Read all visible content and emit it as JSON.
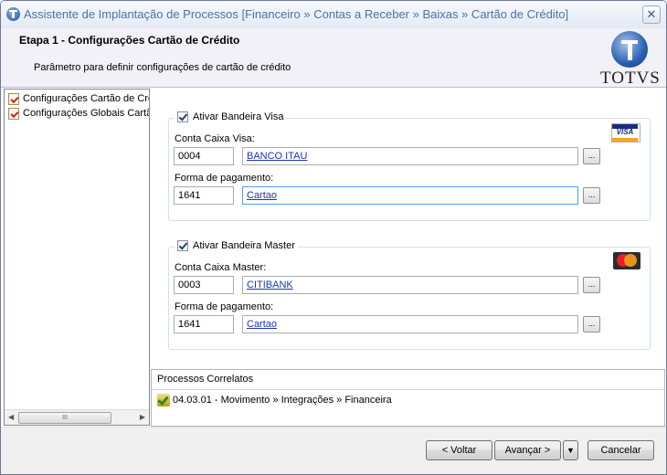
{
  "window": {
    "title": "Assistente de Implantação de Processos [Financeiro » Contas a Receber » Baixas » Cartão de Crédito]",
    "close_symbol": "✕",
    "app_icon": "totvs-circle-icon"
  },
  "header": {
    "step_title": "Etapa 1 - Configurações Cartão de Crédito",
    "step_description": "Parâmetro para definir configurações de cartão de crédito",
    "logo_text": "TOTVS"
  },
  "tree": {
    "items": [
      {
        "label": "Configurações Cartão de Crédito",
        "icon": "checklist-icon"
      },
      {
        "label": "Configurações Globais Cartão",
        "icon": "checklist-icon"
      }
    ],
    "scroll_left": "◀",
    "scroll_right": "▶",
    "scroll_thumb": "III"
  },
  "visa": {
    "checkbox_label": "Ativar Bandeira Visa",
    "checked": true,
    "account_label": "Conta Caixa Visa:",
    "account_code": "0004",
    "account_name": "BANCO ITAU",
    "payment_label": "Forma de pagamento:",
    "payment_code": "1641",
    "payment_name": "Cartao",
    "logo_text": "VISA",
    "lookup_label": "..."
  },
  "master": {
    "checkbox_label": "Ativar Bandeira Master",
    "checked": true,
    "account_label": "Conta Caixa Master:",
    "account_code": "0003",
    "account_name": "CITIBANK",
    "payment_label": "Forma de pagamento:",
    "payment_code": "1641",
    "payment_name": "Cartao",
    "lookup_label": "..."
  },
  "related": {
    "header": "Processos Correlatos",
    "items": [
      {
        "label": "04.03.01 - Movimento » Integrações » Financeira"
      }
    ]
  },
  "footer": {
    "back_label": "< Voltar",
    "next_label": "Avançar >",
    "dropdown_symbol": "▼",
    "cancel_label": "Cancelar"
  }
}
